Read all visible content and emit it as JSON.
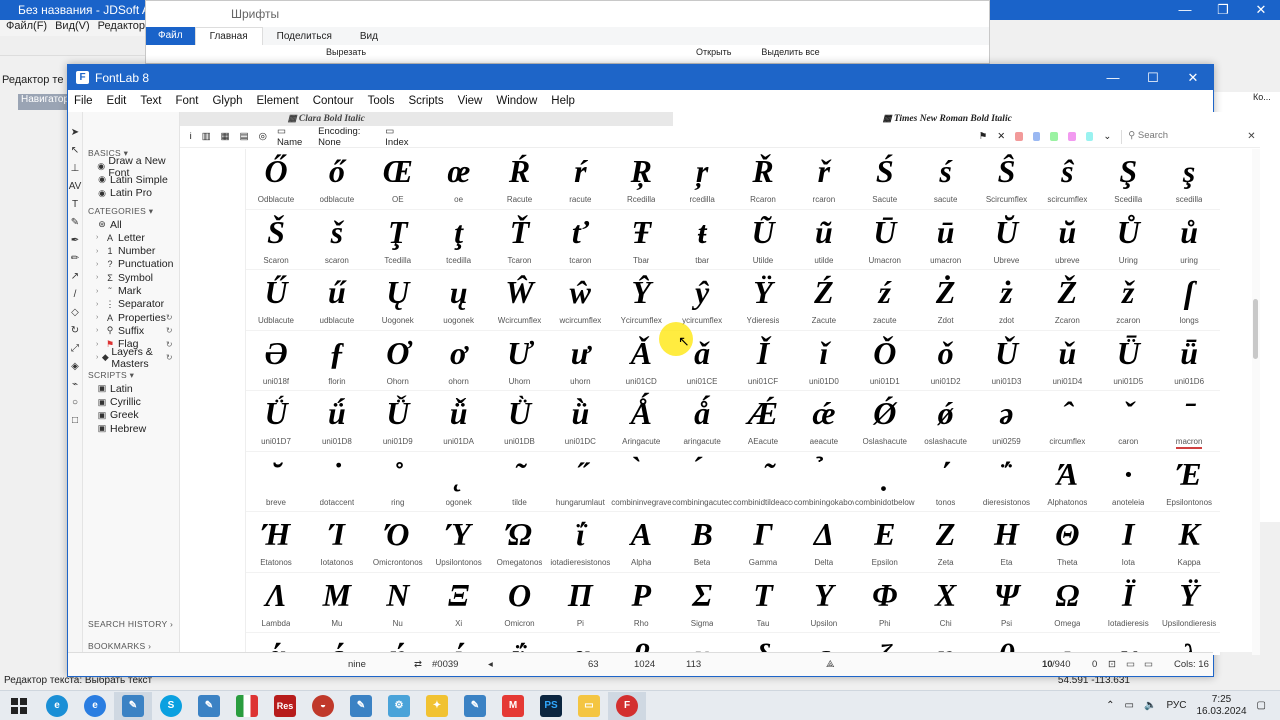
{
  "bg_app": {
    "title": "Без названия - JDSoft ArtFo",
    "menu": [
      "Файл(F)",
      "Вид(V)",
      "Редактор(E"
    ],
    "tab": "Редактор те",
    "navigator": "Навигатор",
    "status": "Редактор текста: Выбрать текст",
    "coords": "54.591 -113.631",
    "panel_header": "Ко..."
  },
  "explorer": {
    "title": "Шрифты",
    "tabs": [
      "Файл",
      "Главная",
      "Поделиться",
      "Вид"
    ],
    "ribbon": [
      "Вырезать",
      "Открыть",
      "Выделить все"
    ]
  },
  "fontlab": {
    "title": "FontLab 8",
    "menu": [
      "File",
      "Edit",
      "Text",
      "Font",
      "Glyph",
      "Element",
      "Contour",
      "Tools",
      "Scripts",
      "View",
      "Window",
      "Help"
    ],
    "font_tab_a": "Clara Bold Italic",
    "font_tab_b": "Times New Roman Bold Italic",
    "toolbar": {
      "name_label": "Name",
      "encoding_label": "Encoding: None",
      "index_label": "Index",
      "search_placeholder": "Search"
    }
  },
  "sidebar": {
    "basics_label": "BASICS",
    "basics": [
      "Draw a New Font",
      "Latin Simple",
      "Latin Pro"
    ],
    "categories_label": "CATEGORIES",
    "categories": [
      "All",
      "Letter",
      "Number",
      "Punctuation",
      "Symbol",
      "Mark",
      "Separator",
      "Properties",
      "Suffix",
      "Flag",
      "Layers & Masters"
    ],
    "scripts_label": "SCRIPTS",
    "scripts": [
      "Latin",
      "Cyrillic",
      "Greek",
      "Hebrew"
    ],
    "search_history": "SEARCH HISTORY",
    "bookmarks": "BOOKMARKS"
  },
  "glyph_rows": [
    {
      "glyphs": [
        "Ő",
        "ő",
        "Œ",
        "œ",
        "Ŕ",
        "ŕ",
        "Ŗ",
        "ŗ",
        "Ř",
        "ř",
        "Ś",
        "ś",
        "Ŝ",
        "ŝ",
        "Ş",
        "ş"
      ],
      "names": [
        "Odblacute",
        "odblacute",
        "OE",
        "oe",
        "Racute",
        "racute",
        "Rcedilla",
        "rcedilla",
        "Rcaron",
        "rcaron",
        "Sacute",
        "sacute",
        "Scircumflex",
        "scircumflex",
        "Scedilla",
        "scedilla"
      ]
    },
    {
      "glyphs": [
        "Š",
        "š",
        "Ţ",
        "ţ",
        "Ť",
        "ť",
        "Ŧ",
        "ŧ",
        "Ũ",
        "ũ",
        "Ū",
        "ū",
        "Ŭ",
        "ŭ",
        "Ů",
        "ů"
      ],
      "names": [
        "Scaron",
        "scaron",
        "Tcedilla",
        "tcedilla",
        "Tcaron",
        "tcaron",
        "Tbar",
        "tbar",
        "Utilde",
        "utilde",
        "Umacron",
        "umacron",
        "Ubreve",
        "ubreve",
        "Uring",
        "uring"
      ]
    },
    {
      "glyphs": [
        "Ű",
        "ű",
        "Ų",
        "ų",
        "Ŵ",
        "ŵ",
        "Ŷ",
        "ŷ",
        "Ÿ",
        "Ź",
        "ź",
        "Ż",
        "ż",
        "Ž",
        "ž",
        "ſ"
      ],
      "names": [
        "Udblacute",
        "udblacute",
        "Uogonek",
        "uogonek",
        "Wcircumflex",
        "wcircumflex",
        "Ycircumflex",
        "ycircumflex",
        "Ydieresis",
        "Zacute",
        "zacute",
        "Zdot",
        "zdot",
        "Zcaron",
        "zcaron",
        "longs"
      ]
    },
    {
      "glyphs": [
        "Ə",
        "ƒ",
        "Ơ",
        "ơ",
        "Ư",
        "ư",
        "Ǎ",
        "ǎ",
        "Ǐ",
        "ǐ",
        "Ǒ",
        "ǒ",
        "Ǔ",
        "ǔ",
        "Ǖ",
        "ǖ"
      ],
      "names": [
        "uni018f",
        "florin",
        "Ohorn",
        "ohorn",
        "Uhorn",
        "uhorn",
        "uni01CD",
        "uni01CE",
        "uni01CF",
        "uni01D0",
        "uni01D1",
        "uni01D2",
        "uni01D3",
        "uni01D4",
        "uni01D5",
        "uni01D6"
      ]
    },
    {
      "glyphs": [
        "Ǘ",
        "ǘ",
        "Ǚ",
        "ǚ",
        "Ǜ",
        "ǜ",
        "Ǻ",
        "ǻ",
        "Ǽ",
        "ǽ",
        "Ǿ",
        "ǿ",
        "ə",
        "ˆ",
        "ˇ",
        "ˉ"
      ],
      "names": [
        "uni01D7",
        "uni01D8",
        "uni01D9",
        "uni01DA",
        "uni01DB",
        "uni01DC",
        "Aringacute",
        "aringacute",
        "AEacute",
        "aeacute",
        "Oslashacute",
        "oslashacute",
        "uni0259",
        "circumflex",
        "caron",
        "macron"
      ]
    },
    {
      "glyphs": [
        "˘",
        "˙",
        "˚",
        "˛",
        "˜",
        "˝",
        "̀",
        "́",
        "̃",
        "̉",
        "̣",
        "΄",
        "΅",
        "Ά",
        "·",
        "Έ"
      ],
      "names": [
        "breve",
        "dotaccent",
        "ring",
        "ogonek",
        "tilde",
        "hungarumlaut",
        "combininvegravecent",
        "combiningacutecent",
        "combinidtildeaccent",
        "combiningokabove",
        "combinidotbelow",
        "tonos",
        "dieresistonos",
        "Alphatonos",
        "anoteleia",
        "Epsilontonos"
      ]
    },
    {
      "glyphs": [
        "Ή",
        "Ί",
        "Ό",
        "Ύ",
        "Ώ",
        "ΐ",
        "Α",
        "Β",
        "Γ",
        "Δ",
        "Ε",
        "Ζ",
        "Η",
        "Θ",
        "Ι",
        "Κ"
      ],
      "names": [
        "Etatonos",
        "Iotatonos",
        "Omicrontonos",
        "Upsilontonos",
        "Omegatonos",
        "iotadieresistonos",
        "Alpha",
        "Beta",
        "Gamma",
        "Delta",
        "Epsilon",
        "Zeta",
        "Eta",
        "Theta",
        "Iota",
        "Kappa"
      ]
    },
    {
      "glyphs": [
        "Λ",
        "Μ",
        "Ν",
        "Ξ",
        "Ο",
        "Π",
        "Ρ",
        "Σ",
        "Τ",
        "Υ",
        "Φ",
        "Χ",
        "Ψ",
        "Ω",
        "Ϊ",
        "Ϋ"
      ],
      "names": [
        "Lambda",
        "Mu",
        "Nu",
        "Xi",
        "Omicron",
        "Pi",
        "Rho",
        "Sigma",
        "Tau",
        "Upsilon",
        "Phi",
        "Chi",
        "Psi",
        "Omega",
        "Iotadieresis",
        "Upsilondieresis"
      ]
    },
    {
      "glyphs": [
        "ά",
        "έ",
        "ή",
        "ί",
        "ΰ",
        "α",
        "β",
        "γ",
        "δ",
        "ε",
        "ζ",
        "η",
        "θ",
        "ι",
        "κ",
        "λ"
      ],
      "names": [
        "",
        "",
        "",
        "",
        "",
        "",
        "",
        "",
        "",
        "",
        "",
        "",
        "",
        "",
        "",
        ""
      ]
    }
  ],
  "bottom_bar": {
    "glyph_name": "nine",
    "code": "#0039",
    "value_a": "63",
    "upm": "1024",
    "value_b": "113",
    "selection": "10",
    "total": "/940",
    "zero": "0",
    "cols": "Cols: 16"
  },
  "taskbar": {
    "lang": "РУС",
    "time": "7:25",
    "date": "16.03.2024",
    "apps": [
      "S",
      "Res",
      "PS"
    ]
  }
}
